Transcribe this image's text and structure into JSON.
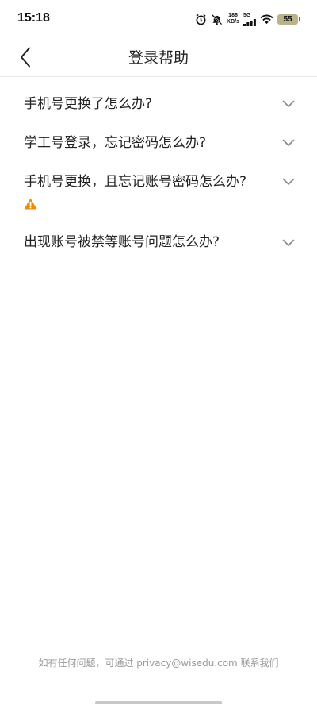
{
  "status_bar": {
    "time": "15:18",
    "net_speed_value": "186",
    "net_speed_unit": "KB/s",
    "signal_label": "5G",
    "battery": "55",
    "icons": [
      "alarm-icon",
      "mute-icon",
      "signal-icon",
      "wifi-icon",
      "battery-icon"
    ]
  },
  "nav": {
    "title": "登录帮助",
    "back_icon": "chevron-left-icon"
  },
  "faq": {
    "items": [
      {
        "question": "手机号更换了怎么办?"
      },
      {
        "question": "学工号登录，忘记密码怎么办?"
      },
      {
        "question": "手机号更换，且忘记账号密码怎么办?",
        "icon": "warning-icon"
      },
      {
        "question": "出现账号被禁等账号问题怎么办?"
      }
    ]
  },
  "footer": {
    "note": "如有任何问题，可通过 privacy@wisedu.com 联系我们"
  },
  "colors": {
    "text": "#222222",
    "muted": "#999999",
    "chevron": "#888888",
    "warning": "#f08a00",
    "divider": "#e8e8e8",
    "battery": "#b8b48a"
  }
}
